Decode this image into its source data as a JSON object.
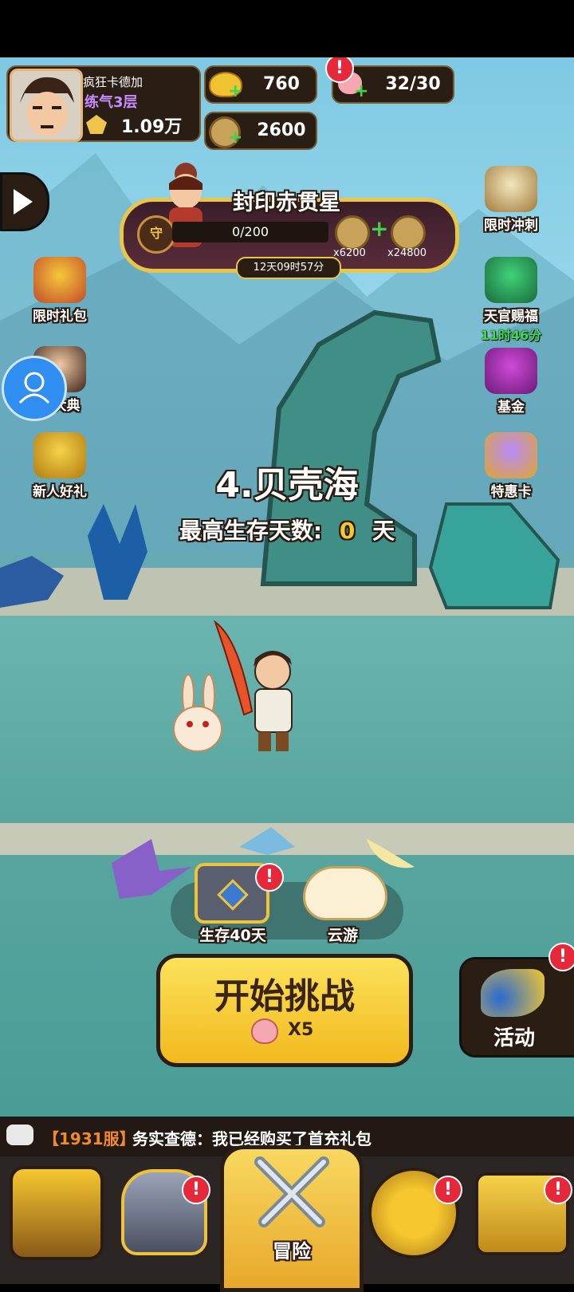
{
  "player": {
    "name": "疯狂卡德加",
    "level": "练气3层",
    "power": "1.09万"
  },
  "resources": {
    "gold": "760",
    "coins": "2600",
    "stamina": "32/30"
  },
  "event": {
    "title": "封印赤贯星",
    "shield_glyph": "守",
    "progress": "0/200",
    "reward1": "x6200",
    "reward2": "x24800",
    "timer": "12天09时57分"
  },
  "left_menu": [
    {
      "label": "限时礼包"
    },
    {
      "label": "痕大典"
    },
    {
      "label": "新人好礼"
    }
  ],
  "right_menu": [
    {
      "label": "限时冲刺"
    },
    {
      "label": "天官赐福",
      "sub": "11时46分"
    },
    {
      "label": "基金"
    },
    {
      "label": "特惠卡"
    }
  ],
  "stage": {
    "name": "4.贝壳海",
    "best_label": "最高生存天数:",
    "best_value": "0",
    "best_unit": "天"
  },
  "chests": {
    "survive": "生存40天",
    "travel": "云游"
  },
  "start": {
    "label": "开始挑战",
    "cost": "X5"
  },
  "activity": {
    "label": "活动"
  },
  "chat": {
    "server": "【1931服】",
    "message": "务实查德：我已经购买了首充礼包"
  },
  "nav": {
    "adventure": "冒险"
  },
  "alert_mark": "!",
  "colors": {
    "accent": "#f6c72e",
    "badge": "#e5283a",
    "level": "#c58cff",
    "timer": "#39e04c"
  }
}
